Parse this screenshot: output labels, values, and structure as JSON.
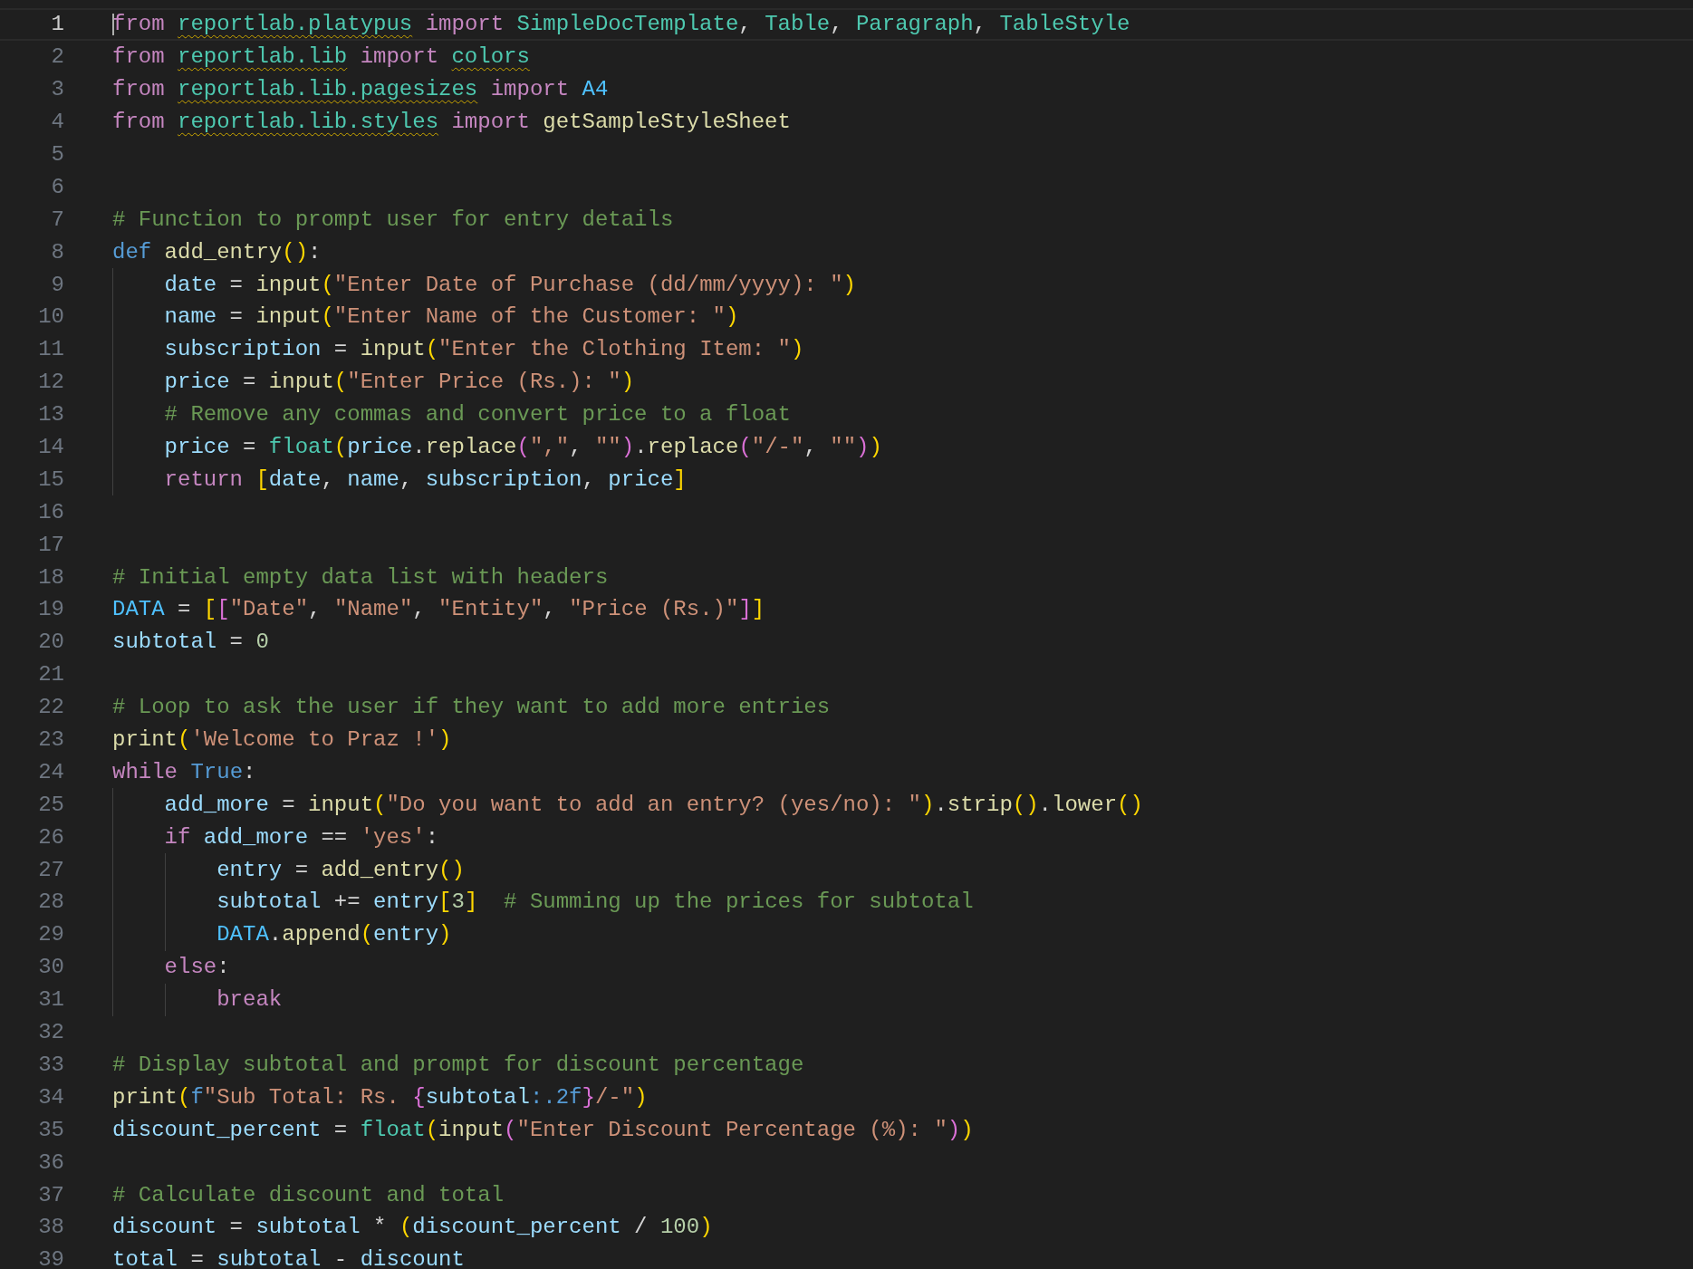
{
  "editor": {
    "lines": [
      {
        "number": "1",
        "active": true,
        "tokens": [
          {
            "kind": "kw",
            "text": "from "
          },
          {
            "kind": "mod",
            "text": "reportlab.platypus"
          },
          {
            "kind": "kw",
            "text": " import "
          },
          {
            "kind": "cls",
            "text": "SimpleDocTemplate"
          },
          {
            "kind": "op",
            "text": ", "
          },
          {
            "kind": "cls",
            "text": "Table"
          },
          {
            "kind": "op",
            "text": ", "
          },
          {
            "kind": "cls",
            "text": "Paragraph"
          },
          {
            "kind": "op",
            "text": ", "
          },
          {
            "kind": "cls",
            "text": "TableStyle"
          }
        ]
      },
      {
        "number": "2",
        "active": false,
        "tokens": [
          {
            "kind": "kw",
            "text": "from "
          },
          {
            "kind": "mod",
            "text": "reportlab.lib"
          },
          {
            "kind": "kw",
            "text": " import "
          },
          {
            "kind": "mod",
            "text": "colors"
          }
        ]
      },
      {
        "number": "3",
        "active": false,
        "tokens": [
          {
            "kind": "kw",
            "text": "from "
          },
          {
            "kind": "mod",
            "text": "reportlab.lib.pagesizes"
          },
          {
            "kind": "kw",
            "text": " import "
          },
          {
            "kind": "const",
            "text": "A4"
          }
        ]
      },
      {
        "number": "4",
        "active": false,
        "tokens": [
          {
            "kind": "kw",
            "text": "from "
          },
          {
            "kind": "mod",
            "text": "reportlab.lib.styles"
          },
          {
            "kind": "kw",
            "text": " import "
          },
          {
            "kind": "fn",
            "text": "getSampleStyleSheet"
          }
        ]
      },
      {
        "number": "5",
        "active": false
      },
      {
        "number": "6",
        "active": false
      },
      {
        "number": "7",
        "active": false,
        "tokens": [
          {
            "kind": "com",
            "text": "# Function to prompt user for entry details"
          }
        ]
      },
      {
        "number": "8",
        "active": false,
        "tokens": [
          {
            "kind": "storage",
            "text": "def "
          },
          {
            "kind": "fn",
            "text": "add_entry"
          },
          {
            "kind": "b1",
            "text": "()"
          },
          {
            "kind": "op",
            "text": ":"
          }
        ]
      },
      {
        "number": "9",
        "active": false,
        "tokens": [
          {
            "kind": "var",
            "text": "    date"
          },
          {
            "kind": "op",
            "text": " = "
          },
          {
            "kind": "fn",
            "text": "input"
          },
          {
            "kind": "b1",
            "text": "("
          },
          {
            "kind": "str",
            "text": "\"Enter Date of Purchase (dd/mm/yyyy): \""
          },
          {
            "kind": "b1",
            "text": ")"
          }
        ]
      },
      {
        "number": "10",
        "active": false,
        "tokens": [
          {
            "kind": "var",
            "text": "    name"
          },
          {
            "kind": "op",
            "text": " = "
          },
          {
            "kind": "fn",
            "text": "input"
          },
          {
            "kind": "b1",
            "text": "("
          },
          {
            "kind": "str",
            "text": "\"Enter Name of the Customer: \""
          },
          {
            "kind": "b1",
            "text": ")"
          }
        ]
      },
      {
        "number": "11",
        "active": false,
        "tokens": [
          {
            "kind": "var",
            "text": "    subscription"
          },
          {
            "kind": "op",
            "text": " = "
          },
          {
            "kind": "fn",
            "text": "input"
          },
          {
            "kind": "b1",
            "text": "("
          },
          {
            "kind": "str",
            "text": "\"Enter the Clothing Item: \""
          },
          {
            "kind": "b1",
            "text": ")"
          }
        ]
      },
      {
        "number": "12",
        "active": false,
        "tokens": [
          {
            "kind": "var",
            "text": "    price"
          },
          {
            "kind": "op",
            "text": " = "
          },
          {
            "kind": "fn",
            "text": "input"
          },
          {
            "kind": "b1",
            "text": "("
          },
          {
            "kind": "str",
            "text": "\"Enter Price (Rs.): \""
          },
          {
            "kind": "b1",
            "text": ")"
          }
        ]
      },
      {
        "number": "13",
        "active": false,
        "tokens": [
          {
            "kind": "com",
            "text": "    # Remove any commas and convert price to a float"
          }
        ]
      },
      {
        "number": "14",
        "active": false,
        "tokens": [
          {
            "kind": "var",
            "text": "    price"
          },
          {
            "kind": "op",
            "text": " = "
          },
          {
            "kind": "cls",
            "text": "float"
          },
          {
            "kind": "b1",
            "text": "("
          },
          {
            "kind": "var",
            "text": "price"
          },
          {
            "kind": "op",
            "text": "."
          },
          {
            "kind": "fn",
            "text": "replace"
          },
          {
            "kind": "b2",
            "text": "("
          },
          {
            "kind": "str",
            "text": "\",\""
          },
          {
            "kind": "op",
            "text": ", "
          },
          {
            "kind": "str",
            "text": "\"\""
          },
          {
            "kind": "b2",
            "text": ")"
          },
          {
            "kind": "op",
            "text": "."
          },
          {
            "kind": "fn",
            "text": "replace"
          },
          {
            "kind": "b2",
            "text": "("
          },
          {
            "kind": "str",
            "text": "\"/-\""
          },
          {
            "kind": "op",
            "text": ", "
          },
          {
            "kind": "str",
            "text": "\"\""
          },
          {
            "kind": "b2",
            "text": ")"
          },
          {
            "kind": "b1",
            "text": ")"
          }
        ]
      },
      {
        "number": "15",
        "active": false,
        "tokens": [
          {
            "kind": "kw",
            "text": "    return "
          },
          {
            "kind": "b1",
            "text": "["
          },
          {
            "kind": "var",
            "text": "date"
          },
          {
            "kind": "op",
            "text": ", "
          },
          {
            "kind": "var",
            "text": "name"
          },
          {
            "kind": "op",
            "text": ", "
          },
          {
            "kind": "var",
            "text": "subscription"
          },
          {
            "kind": "op",
            "text": ", "
          },
          {
            "kind": "var",
            "text": "price"
          },
          {
            "kind": "b1",
            "text": "]"
          }
        ]
      },
      {
        "number": "16",
        "active": false
      },
      {
        "number": "17",
        "active": false
      },
      {
        "number": "18",
        "active": false,
        "tokens": [
          {
            "kind": "com",
            "text": "# Initial empty data list with headers"
          }
        ]
      },
      {
        "number": "19",
        "active": false,
        "tokens": [
          {
            "kind": "const",
            "text": "DATA"
          },
          {
            "kind": "op",
            "text": " = "
          },
          {
            "kind": "b1",
            "text": "["
          },
          {
            "kind": "b2",
            "text": "["
          },
          {
            "kind": "str",
            "text": "\"Date\""
          },
          {
            "kind": "op",
            "text": ", "
          },
          {
            "kind": "str",
            "text": "\"Name\""
          },
          {
            "kind": "op",
            "text": ", "
          },
          {
            "kind": "str",
            "text": "\"Entity\""
          },
          {
            "kind": "op",
            "text": ", "
          },
          {
            "kind": "str",
            "text": "\"Price (Rs.)\""
          },
          {
            "kind": "b2",
            "text": "]"
          },
          {
            "kind": "b1",
            "text": "]"
          }
        ]
      },
      {
        "number": "20",
        "active": false,
        "tokens": [
          {
            "kind": "var",
            "text": "subtotal"
          },
          {
            "kind": "op",
            "text": " = "
          },
          {
            "kind": "num",
            "text": "0"
          }
        ]
      },
      {
        "number": "21",
        "active": false
      },
      {
        "number": "22",
        "active": false,
        "tokens": [
          {
            "kind": "com",
            "text": "# Loop to ask the user if they want to add more entries"
          }
        ]
      },
      {
        "number": "23",
        "active": false,
        "tokens": [
          {
            "kind": "fn",
            "text": "print"
          },
          {
            "kind": "b1",
            "text": "("
          },
          {
            "kind": "str",
            "text": "'Welcome to Praz !'"
          },
          {
            "kind": "b1",
            "text": ")"
          }
        ]
      },
      {
        "number": "24",
        "active": false,
        "tokens": [
          {
            "kind": "kw",
            "text": "while "
          },
          {
            "kind": "storage",
            "text": "True"
          },
          {
            "kind": "op",
            "text": ":"
          }
        ]
      },
      {
        "number": "25",
        "active": false,
        "tokens": [
          {
            "kind": "var",
            "text": "    add_more"
          },
          {
            "kind": "op",
            "text": " = "
          },
          {
            "kind": "fn",
            "text": "input"
          },
          {
            "kind": "b1",
            "text": "("
          },
          {
            "kind": "str",
            "text": "\"Do you want to add an entry? (yes/no): \""
          },
          {
            "kind": "b1",
            "text": ")"
          },
          {
            "kind": "op",
            "text": "."
          },
          {
            "kind": "fn",
            "text": "strip"
          },
          {
            "kind": "b1",
            "text": "()"
          },
          {
            "kind": "op",
            "text": "."
          },
          {
            "kind": "fn",
            "text": "lower"
          },
          {
            "kind": "b1",
            "text": "()"
          }
        ]
      },
      {
        "number": "26",
        "active": false,
        "tokens": [
          {
            "kind": "kw",
            "text": "    if "
          },
          {
            "kind": "var",
            "text": "add_more"
          },
          {
            "kind": "op",
            "text": " == "
          },
          {
            "kind": "str",
            "text": "'yes'"
          },
          {
            "kind": "op",
            "text": ":"
          }
        ]
      },
      {
        "number": "27",
        "active": false,
        "tokens": [
          {
            "kind": "var",
            "text": "        entry"
          },
          {
            "kind": "op",
            "text": " = "
          },
          {
            "kind": "fn",
            "text": "add_entry"
          },
          {
            "kind": "b1",
            "text": "()"
          }
        ]
      },
      {
        "number": "28",
        "active": false,
        "tokens": [
          {
            "kind": "var",
            "text": "        subtotal"
          },
          {
            "kind": "op",
            "text": " += "
          },
          {
            "kind": "var",
            "text": "entry"
          },
          {
            "kind": "b1",
            "text": "["
          },
          {
            "kind": "num",
            "text": "3"
          },
          {
            "kind": "b1",
            "text": "]"
          },
          {
            "kind": "com",
            "text": "  # Summing up the prices for subtotal"
          }
        ]
      },
      {
        "number": "29",
        "active": false,
        "tokens": [
          {
            "kind": "const",
            "text": "        DATA"
          },
          {
            "kind": "op",
            "text": "."
          },
          {
            "kind": "fn",
            "text": "append"
          },
          {
            "kind": "b1",
            "text": "("
          },
          {
            "kind": "var",
            "text": "entry"
          },
          {
            "kind": "b1",
            "text": ")"
          }
        ]
      },
      {
        "number": "30",
        "active": false,
        "tokens": [
          {
            "kind": "kw",
            "text": "    else"
          },
          {
            "kind": "op",
            "text": ":"
          }
        ]
      },
      {
        "number": "31",
        "active": false,
        "tokens": [
          {
            "kind": "kw",
            "text": "        break"
          }
        ]
      },
      {
        "number": "32",
        "active": false
      },
      {
        "number": "33",
        "active": false,
        "tokens": [
          {
            "kind": "com",
            "text": "# Display subtotal and prompt for discount percentage"
          }
        ]
      },
      {
        "number": "34",
        "active": false,
        "tokens": [
          {
            "kind": "fn",
            "text": "print"
          },
          {
            "kind": "b1",
            "text": "("
          },
          {
            "kind": "storage",
            "text": "f"
          },
          {
            "kind": "str",
            "text": "\"Sub Total: Rs. "
          },
          {
            "kind": "b2",
            "text": "{"
          },
          {
            "kind": "var",
            "text": "subtotal"
          },
          {
            "kind": "storage",
            "text": ":.2f"
          },
          {
            "kind": "b2",
            "text": "}"
          },
          {
            "kind": "str",
            "text": "/-\""
          },
          {
            "kind": "b1",
            "text": ")"
          }
        ]
      },
      {
        "number": "35",
        "active": false,
        "tokens": [
          {
            "kind": "var",
            "text": "discount_percent"
          },
          {
            "kind": "op",
            "text": " = "
          },
          {
            "kind": "cls",
            "text": "float"
          },
          {
            "kind": "b1",
            "text": "("
          },
          {
            "kind": "fn",
            "text": "input"
          },
          {
            "kind": "b2",
            "text": "("
          },
          {
            "kind": "str",
            "text": "\"Enter Discount Percentage (%): \""
          },
          {
            "kind": "b2",
            "text": ")"
          },
          {
            "kind": "b1",
            "text": ")"
          }
        ]
      },
      {
        "number": "36",
        "active": false
      },
      {
        "number": "37",
        "active": false,
        "tokens": [
          {
            "kind": "com",
            "text": "# Calculate discount and total"
          }
        ]
      },
      {
        "number": "38",
        "active": false,
        "tokens": [
          {
            "kind": "var",
            "text": "discount"
          },
          {
            "kind": "op",
            "text": " = "
          },
          {
            "kind": "var",
            "text": "subtotal"
          },
          {
            "kind": "op",
            "text": " * "
          },
          {
            "kind": "b1",
            "text": "("
          },
          {
            "kind": "var",
            "text": "discount_percent"
          },
          {
            "kind": "op",
            "text": " / "
          },
          {
            "kind": "num",
            "text": "100"
          },
          {
            "kind": "b1",
            "text": ")"
          }
        ]
      },
      {
        "number": "39",
        "active": false,
        "tokens": [
          {
            "kind": "var",
            "text": "total"
          },
          {
            "kind": "op",
            "text": " = "
          },
          {
            "kind": "var",
            "text": "subtotal"
          },
          {
            "kind": "op",
            "text": " - "
          },
          {
            "kind": "var",
            "text": "discount"
          }
        ]
      }
    ]
  }
}
